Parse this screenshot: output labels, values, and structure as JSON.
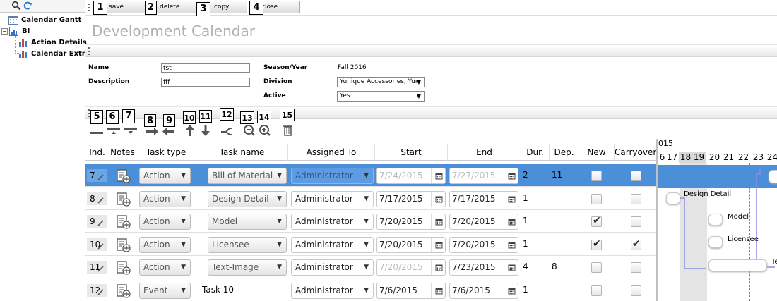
{
  "sidebar": {
    "tree": [
      {
        "label": "Calendar Gantt",
        "icon": "calendar-icon"
      },
      {
        "label": "BI",
        "icon": "report-icon"
      },
      {
        "label": "Action Details",
        "icon": "bar-chart-icon"
      },
      {
        "label": "Calendar Extract",
        "icon": "bar-chart-icon"
      }
    ]
  },
  "toolbar": {
    "buttons": [
      {
        "label": "save",
        "badge": "1"
      },
      {
        "label": "delete",
        "badge": "2"
      },
      {
        "label": "copy",
        "badge": "3"
      },
      {
        "label": "close",
        "badge": "4"
      }
    ]
  },
  "page": {
    "title": "Development Calendar"
  },
  "form": {
    "name_label": "Name",
    "name_value": "tst",
    "description_label": "Description",
    "description_value": "fff",
    "season_label": "Season/Year",
    "season_value": "Fall 2016",
    "division_label": "Division",
    "division_value": "Yunique Accessories, Yun",
    "active_label": "Active",
    "active_value": "Yes"
  },
  "grid_toolbar": {
    "badges": [
      "5",
      "6",
      "7",
      "8",
      "9",
      "10",
      "11",
      "12",
      "13",
      "14",
      "15"
    ],
    "icons": [
      "add-row-icon",
      "insert-above-icon",
      "insert-below-icon",
      "indent-icon",
      "outdent-icon",
      "move-up-icon",
      "move-down-icon",
      "link-tasks-icon",
      "zoom-out-icon",
      "zoom-in-icon",
      "trash-icon"
    ]
  },
  "grid": {
    "columns": [
      "Ind.",
      "Notes",
      "Task type",
      "Task name",
      "Assigned To",
      "Start",
      "End",
      "Dur.",
      "Dep.",
      "New",
      "Carryover"
    ],
    "rows": [
      {
        "ind": "7",
        "type": "Action",
        "name": "Bill of Material",
        "name_select": true,
        "assigned": "Administrator",
        "start": "7/24/2015",
        "end": "7/27/2015",
        "dur": "2",
        "dep": "11",
        "new": false,
        "carryover": false,
        "selected": true
      },
      {
        "ind": "8",
        "type": "Action",
        "name": "Design Detail",
        "name_select": true,
        "assigned": "Administrator",
        "start": "7/17/2015",
        "end": "7/17/2015",
        "dur": "1",
        "dep": "",
        "new": false,
        "carryover": false,
        "selected": false
      },
      {
        "ind": "9",
        "type": "Action",
        "name": "Model",
        "name_select": true,
        "assigned": "Administrator",
        "start": "7/20/2015",
        "end": "7/20/2015",
        "dur": "1",
        "dep": "",
        "new": true,
        "carryover": false,
        "selected": false
      },
      {
        "ind": "10",
        "type": "Action",
        "name": "Licensee",
        "name_select": true,
        "assigned": "Administrator",
        "start": "7/20/2015",
        "end": "7/20/2015",
        "dur": "1",
        "dep": "",
        "new": true,
        "carryover": true,
        "selected": false
      },
      {
        "ind": "11",
        "type": "Action",
        "name": "Text-Image",
        "name_select": true,
        "assigned": "Administrator",
        "start": "7/20/2015",
        "end": "7/23/2015",
        "dur": "4",
        "dep": "8",
        "new": false,
        "carryover": false,
        "selected": false
      },
      {
        "ind": "12",
        "type": "Event",
        "name": "Task 10",
        "name_select": false,
        "assigned": "Administrator",
        "start": "7/6/2015",
        "end": "7/6/2015",
        "dur": "1",
        "dep": "",
        "new": false,
        "carryover": false,
        "selected": false
      }
    ]
  },
  "gantt": {
    "year_label": "015",
    "days": [
      "6",
      "17",
      "18",
      "19",
      "20",
      "21",
      "22",
      "23",
      "24"
    ],
    "labels": [
      "Design Detail",
      "Model",
      "Licensee",
      "Te"
    ]
  },
  "colors": {
    "selected_row": "#4a8fd8",
    "title_gray": "#b0b0b0",
    "gantt_link": "#8c8ce6",
    "today_line": "#2aa"
  }
}
